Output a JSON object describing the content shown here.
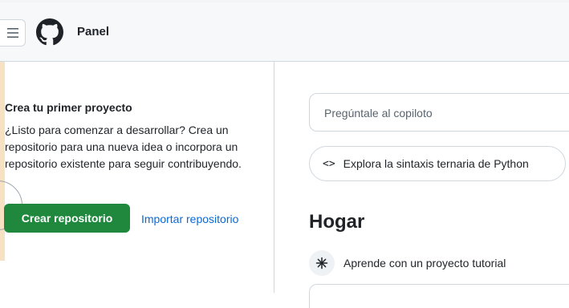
{
  "header": {
    "title": "Panel",
    "menu_icon": "hamburger-menu-icon",
    "logo_icon": "github-logo-icon"
  },
  "left_panel": {
    "heading": "Crea tu primer proyecto",
    "description": "¿Listo para comenzar a desarrollar? Crea un repositorio para una nueva idea o incorpora un repositorio existente para seguir contribuyendo.",
    "create_button": "Crear repositorio",
    "import_link": "Importar repositorio"
  },
  "main": {
    "copilot_placeholder": "Pregúntale al copiloto",
    "suggestion_pill": "Explora la sintaxis ternaria de Python",
    "suggestion_icon": "code-icon",
    "home_title": "Hogar",
    "tutorial_label": "Aprende con un proyecto tutorial",
    "tutorial_icon": "sparkle-icon"
  },
  "colors": {
    "primary_button": "#1f883d",
    "link": "#0969da",
    "border": "#d0d7de",
    "accent_strip": "#f6e1c3"
  }
}
